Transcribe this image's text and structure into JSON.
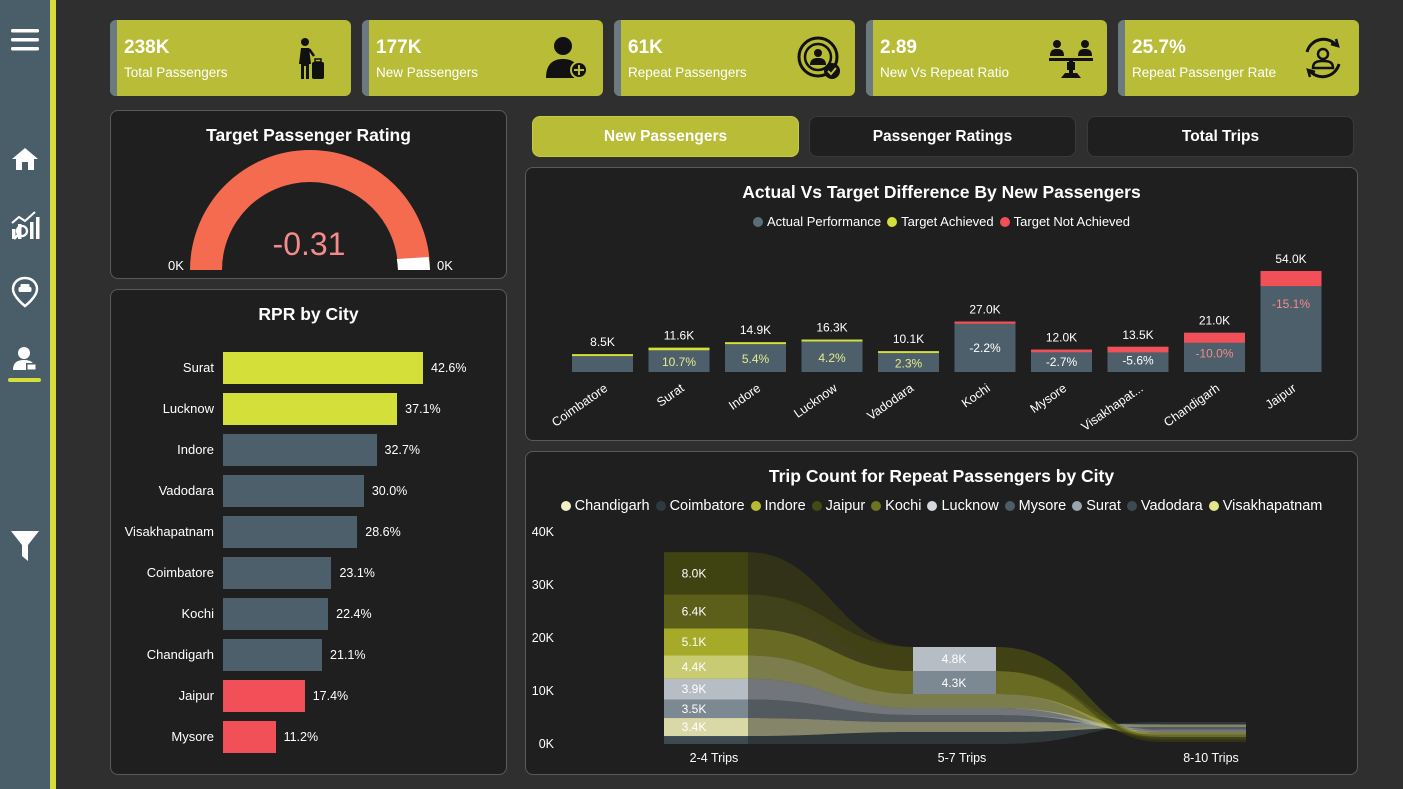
{
  "kpis": [
    {
      "value": "238K",
      "label": "Total Passengers",
      "icon": "traveler-icon"
    },
    {
      "value": "177K",
      "label": "New Passengers",
      "icon": "add-user-icon"
    },
    {
      "value": "61K",
      "label": "Repeat Passengers",
      "icon": "repeat-user-icon"
    },
    {
      "value": "2.89",
      "label": "New Vs Repeat Ratio",
      "icon": "balance-users-icon"
    },
    {
      "value": "25.7%",
      "label": "Repeat Passenger Rate",
      "icon": "cycle-user-icon"
    }
  ],
  "gauge": {
    "title": "Target Passenger Rating",
    "value": "-0.31",
    "min_label": "0K",
    "max_label": "0K",
    "colors": {
      "arc": "#f56b4f",
      "value_text": "#f58a8a"
    }
  },
  "tabs": [
    {
      "label": "New Passengers",
      "active": true
    },
    {
      "label": "Passenger Ratings",
      "active": false
    },
    {
      "label": "Total Trips",
      "active": false
    }
  ],
  "rpr": {
    "title": "RPR by City",
    "colors": {
      "high": "#d4df3a",
      "mid": "#4d5f6b",
      "low": "#f25058"
    },
    "items": [
      {
        "city": "Surat",
        "value": 42.6,
        "label": "42.6%",
        "tier": "high"
      },
      {
        "city": "Lucknow",
        "value": 37.1,
        "label": "37.1%",
        "tier": "high"
      },
      {
        "city": "Indore",
        "value": 32.7,
        "label": "32.7%",
        "tier": "mid"
      },
      {
        "city": "Vadodara",
        "value": 30.0,
        "label": "30.0%",
        "tier": "mid"
      },
      {
        "city": "Visakhapatnam",
        "value": 28.6,
        "label": "28.6%",
        "tier": "mid"
      },
      {
        "city": "Coimbatore",
        "value": 23.1,
        "label": "23.1%",
        "tier": "mid"
      },
      {
        "city": "Kochi",
        "value": 22.4,
        "label": "22.4%",
        "tier": "mid"
      },
      {
        "city": "Chandigarh",
        "value": 21.1,
        "label": "21.1%",
        "tier": "mid"
      },
      {
        "city": "Jaipur",
        "value": 17.4,
        "label": "17.4%",
        "tier": "low"
      },
      {
        "city": "Mysore",
        "value": 11.2,
        "label": "11.2%",
        "tier": "low"
      }
    ]
  },
  "chart_data": [
    {
      "type": "bar",
      "title": "Actual Vs Target Difference By New Passengers",
      "legend": [
        {
          "name": "Actual Performance",
          "color": "#5a6e7a"
        },
        {
          "name": "Target Achieved",
          "color": "#d4df3a"
        },
        {
          "name": "Target Not Achieved",
          "color": "#f25058"
        }
      ],
      "categories": [
        "Coimbatore",
        "Surat",
        "Indore",
        "Lucknow",
        "Vadodara",
        "Kochi",
        "Mysore",
        "Visakhapat...",
        "Chandigarh",
        "Jaipur"
      ],
      "actual": [
        8.5,
        11.6,
        14.9,
        16.3,
        10.1,
        27.0,
        12.0,
        13.5,
        21.0,
        54.0
      ],
      "actual_labels": [
        "8.5K",
        "11.6K",
        "14.9K",
        "16.3K",
        "10.1K",
        "27.0K",
        "12.0K",
        "13.5K",
        "21.0K",
        "54.0K"
      ],
      "diff_pct": [
        0.0,
        10.7,
        5.4,
        4.2,
        2.3,
        -2.2,
        -2.7,
        -5.6,
        -10.0,
        -15.1
      ],
      "diff_labels": [
        "",
        "10.7%",
        "5.4%",
        "4.2%",
        "2.3%",
        "-2.2%",
        "-2.7%",
        "-5.6%",
        "-10.0%",
        "-15.1%"
      ]
    },
    {
      "type": "area",
      "title": "Trip Count for Repeat Passengers by City",
      "x": [
        "2-4 Trips",
        "5-7 Trips",
        "8-10 Trips"
      ],
      "yticks": [
        "40K",
        "30K",
        "20K",
        "10K",
        "0K"
      ],
      "ylim": [
        0,
        40
      ],
      "legend": [
        {
          "name": "Chandigarh",
          "color": "#f2f0c8"
        },
        {
          "name": "Coimbatore",
          "color": "#2e3a40"
        },
        {
          "name": "Indore",
          "color": "#b6bb30"
        },
        {
          "name": "Jaipur",
          "color": "#454a12"
        },
        {
          "name": "Kochi",
          "color": "#6e7320"
        },
        {
          "name": "Lucknow",
          "color": "#d5d8dc"
        },
        {
          "name": "Mysore",
          "color": "#4e5c66"
        },
        {
          "name": "Surat",
          "color": "#9aa5ad"
        },
        {
          "name": "Vadodara",
          "color": "#3e4a52"
        },
        {
          "name": "Visakhapatnam",
          "color": "#e3e78a"
        }
      ],
      "bands_2_4": [
        {
          "label": "",
          "value": 1.5,
          "color": "#3e4a52"
        },
        {
          "label": "3.4K",
          "value": 3.4,
          "color": "#d8d9a6"
        },
        {
          "label": "3.5K",
          "value": 3.5,
          "color": "#7c8993"
        },
        {
          "label": "3.9K",
          "value": 3.9,
          "color": "#b7bdc4"
        },
        {
          "label": "4.4K",
          "value": 4.4,
          "color": "#c9cb72"
        },
        {
          "label": "5.1K",
          "value": 5.1,
          "color": "#a5aa28"
        },
        {
          "label": "6.4K",
          "value": 6.4,
          "color": "#5b5f1a"
        },
        {
          "label": "8.0K",
          "value": 8.0,
          "color": "#3f4211"
        }
      ],
      "labels_5_7": [
        "4.8K",
        "4.3K"
      ]
    }
  ]
}
